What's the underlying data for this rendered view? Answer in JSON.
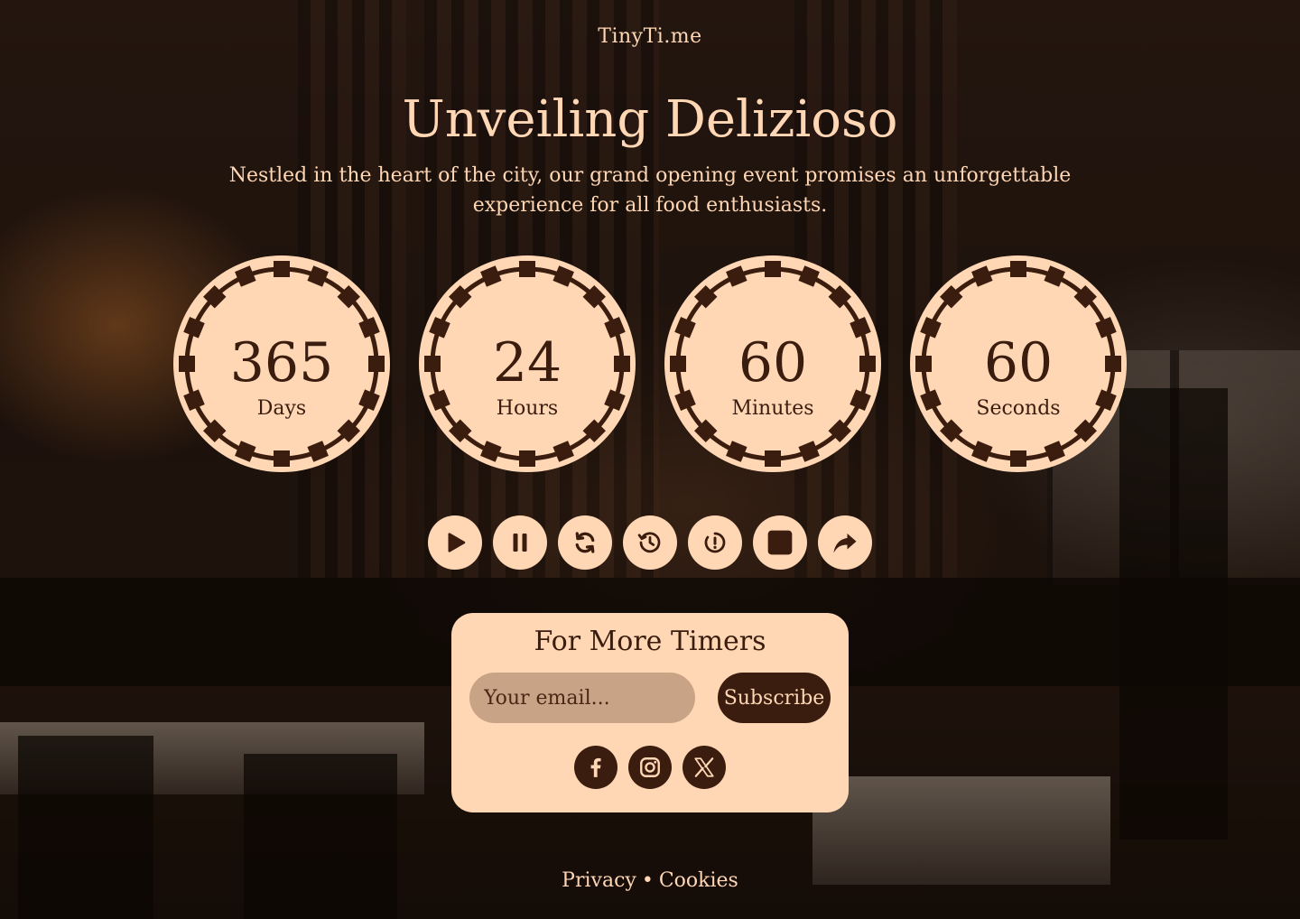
{
  "brand": "TinyTi.me",
  "hero": {
    "title": "Unveiling Delizioso",
    "subtitle": "Nestled in the heart of the city, our grand opening event promises an unforgettable experience for all food enthusiasts."
  },
  "countdown": [
    {
      "value": "365",
      "label": "Days"
    },
    {
      "value": "24",
      "label": "Hours"
    },
    {
      "value": "60",
      "label": "Minutes"
    },
    {
      "value": "60",
      "label": "Seconds"
    }
  ],
  "controls": [
    "play-icon",
    "pause-icon",
    "refresh-icon",
    "history-icon",
    "timer-icon",
    "stop-icon",
    "share-icon"
  ],
  "subscribe": {
    "title": "For More Timers",
    "email_placeholder": "Your email...",
    "button_label": "Subscribe",
    "socials": [
      "facebook-icon",
      "instagram-icon",
      "x-icon"
    ]
  },
  "footer": {
    "privacy": "Privacy",
    "separator": "•",
    "cookies": "Cookies"
  },
  "colors": {
    "accent": "#ffd7b5",
    "dark": "#3a1d0e",
    "input_bg": "#c9a386"
  }
}
